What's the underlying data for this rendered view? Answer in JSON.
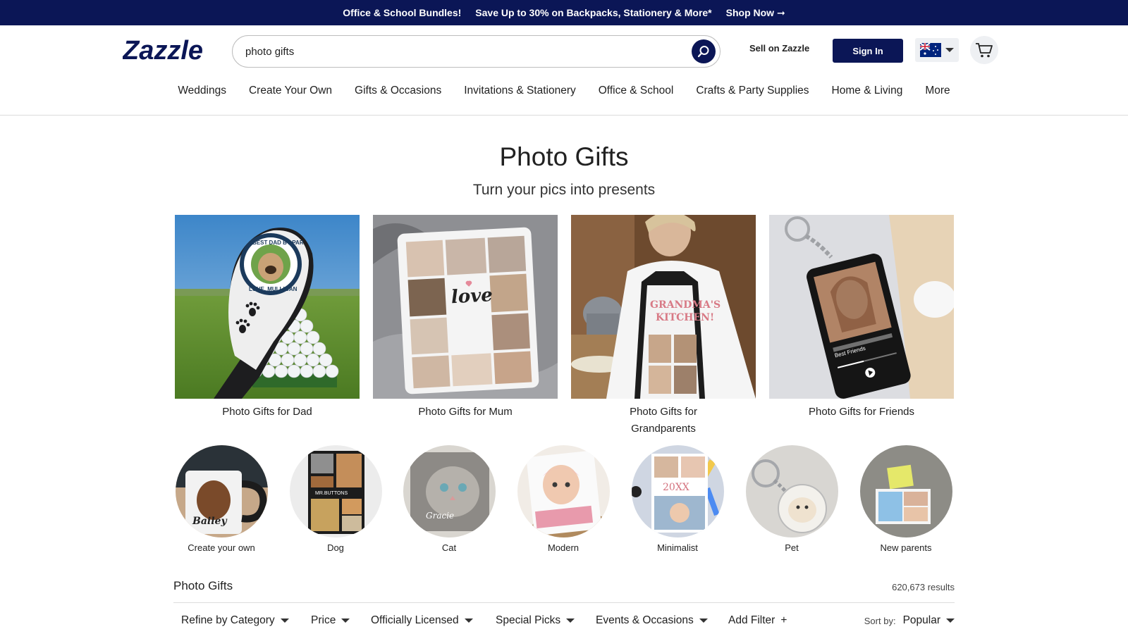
{
  "promo": {
    "bundles": "Office & School Bundles!",
    "offer": "Save Up to 30% on Backpacks, Stationery & More*",
    "shop_now": "Shop Now ➞"
  },
  "header": {
    "logo": "Zazzle",
    "search_value": "photo gifts",
    "sell": "Sell on Zazzle",
    "sign_in": "Sign In"
  },
  "nav": [
    "Weddings",
    "Create Your Own",
    "Gifts & Occasions",
    "Invitations & Stationery",
    "Office & School",
    "Crafts & Party Supplies",
    "Home & Living",
    "More"
  ],
  "hero": {
    "title": "Photo Gifts",
    "subtitle": "Turn your pics into presents"
  },
  "cards": [
    {
      "label": "Photo Gifts for Dad"
    },
    {
      "label": "Photo Gifts for Mum"
    },
    {
      "label": "Photo Gifts for Grandparents"
    },
    {
      "label": "Photo Gifts for Friends"
    }
  ],
  "circles": [
    {
      "label": "Create your own"
    },
    {
      "label": "Dog"
    },
    {
      "label": "Cat"
    },
    {
      "label": "Modern"
    },
    {
      "label": "Minimalist"
    },
    {
      "label": "Pet"
    },
    {
      "label": "New parents"
    }
  ],
  "product_art": {
    "golf_cover": {
      "ring_text_top": "BEST DAD BY PAR",
      "ring_text_bottom": "LOVE, MULLIGAN"
    },
    "pillow": {
      "word": "love"
    },
    "apron": {
      "line1": "GRANDMA'S",
      "line2": "KITCHEN!"
    },
    "keychain": {
      "song": "Best Friends"
    },
    "mug": {
      "name": "Bailey"
    },
    "dog_blanket": {
      "name": "MR.BUTTONS"
    },
    "cat_pillow": {
      "name": "Gracie"
    },
    "calendar": {
      "year": "20XX"
    }
  },
  "results": {
    "title": "Photo Gifts",
    "count": "620,673 results",
    "filters": [
      "Refine by Category",
      "Price",
      "Officially Licensed",
      "Special Picks",
      "Events & Occasions"
    ],
    "add_filter": "Add Filter",
    "add_filter_icon": "+",
    "sort_label": "Sort by:",
    "sort_value": "Popular"
  },
  "colors": {
    "brand_navy": "#0b1656"
  }
}
